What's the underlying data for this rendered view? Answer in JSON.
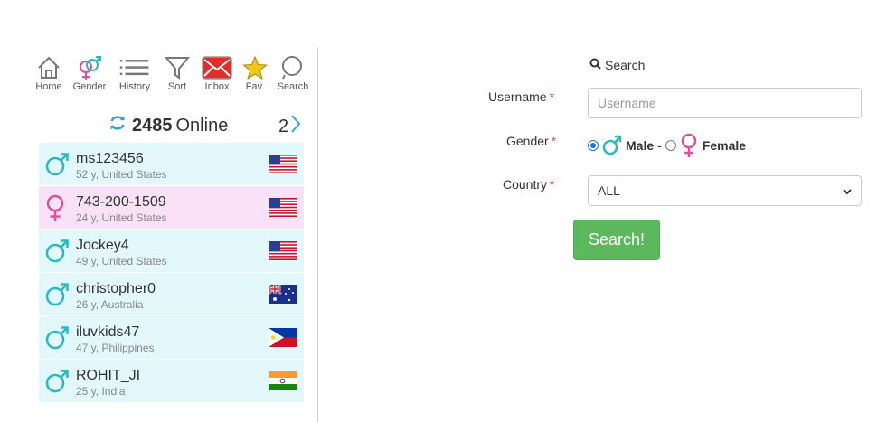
{
  "toolbar": {
    "items": [
      {
        "label": "Home",
        "icon": "home-icon"
      },
      {
        "label": "Gender",
        "icon": "gender-icon"
      },
      {
        "label": "History",
        "icon": "list-icon"
      },
      {
        "label": "Sort",
        "icon": "filter-icon"
      },
      {
        "label": "Inbox",
        "icon": "envelope-icon"
      },
      {
        "label": "Fav.",
        "icon": "star-icon"
      },
      {
        "label": "Search",
        "icon": "search-icon"
      }
    ]
  },
  "online": {
    "count": "2485",
    "label": "Online",
    "page": "2"
  },
  "users": [
    {
      "username": "ms123456",
      "meta": "52 y, United States",
      "gender": "male",
      "flag": "us-flag-icon"
    },
    {
      "username": "743-200-1509",
      "meta": "24 y, United States",
      "gender": "female",
      "flag": "us-flag-icon"
    },
    {
      "username": "Jockey4",
      "meta": "49 y, United States",
      "gender": "male",
      "flag": "us-flag-icon"
    },
    {
      "username": "christopher0",
      "meta": "26 y, Australia",
      "gender": "male",
      "flag": "au-flag-icon"
    },
    {
      "username": "iluvkids47",
      "meta": "47 y, Philippines",
      "gender": "male",
      "flag": "ph-flag-icon"
    },
    {
      "username": "ROHIT_JI",
      "meta": "25 y, India",
      "gender": "male",
      "flag": "in-flag-icon"
    }
  ],
  "search": {
    "heading": "Search",
    "username_label": "Username",
    "username_placeholder": "Username",
    "gender_label": "Gender",
    "male_label": "Male",
    "separator": "-",
    "female_label": "Female",
    "country_label": "Country",
    "country_value": "ALL",
    "button_label": "Search!",
    "required_mark": "*"
  },
  "colors": {
    "male": "#29b8c4",
    "female": "#e0509a",
    "row_male_bg": "#e2f8fb",
    "row_female_bg": "#f9e2f7",
    "button_bg": "#5cb85c",
    "required": "#d9534f"
  }
}
